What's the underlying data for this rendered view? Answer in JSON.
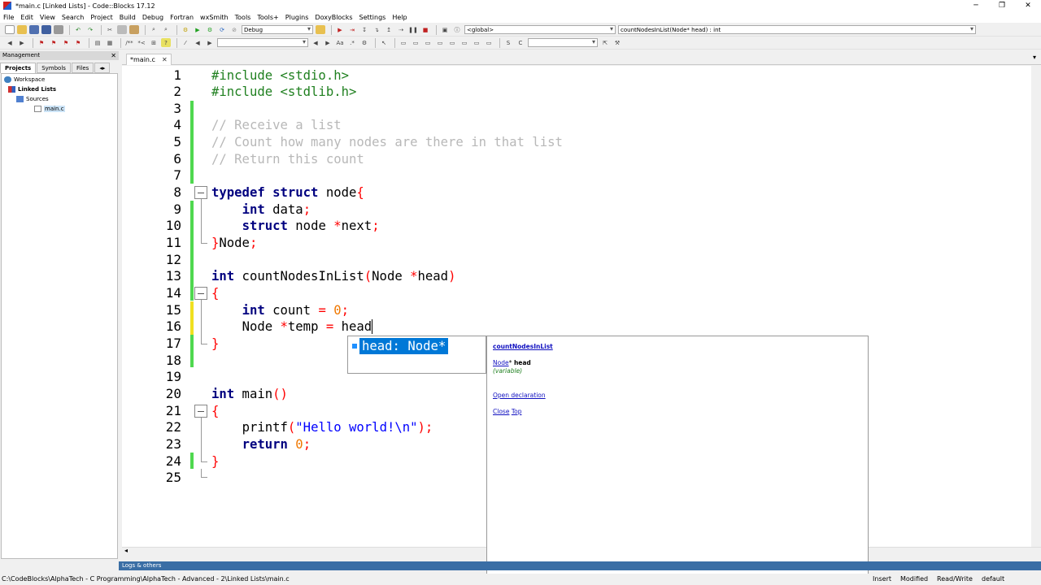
{
  "window": {
    "title": "*main.c [Linked Lists] - Code::Blocks 17.12",
    "controls": [
      "─",
      "❐",
      "✕"
    ]
  },
  "menu": [
    "File",
    "Edit",
    "View",
    "Search",
    "Project",
    "Build",
    "Debug",
    "Fortran",
    "wxSmith",
    "Tools",
    "Tools+",
    "Plugins",
    "DoxyBlocks",
    "Settings",
    "Help"
  ],
  "toolbar": {
    "build_target": "Debug",
    "scope": "<global>",
    "function": "countNodesInList(Node* head) : int"
  },
  "management": {
    "title": "Management",
    "close": "✕",
    "tabs": [
      "Projects",
      "Symbols",
      "Files"
    ],
    "tree": {
      "workspace": "Workspace",
      "project": "Linked Lists",
      "folder": "Sources",
      "file": "main.c"
    }
  },
  "editor": {
    "tab_label": "*main.c",
    "tab_close": "✕",
    "tabs_menu": "▾",
    "line_numbers": [
      "1",
      "2",
      "3",
      "4",
      "5",
      "6",
      "7",
      "8",
      "9",
      "10",
      "11",
      "12",
      "13",
      "14",
      "15",
      "16",
      "17",
      "18",
      "19",
      "20",
      "21",
      "22",
      "23",
      "24",
      "25"
    ],
    "code": {
      "l1": "#include <stdio.h>",
      "l2": "#include <stdlib.h>",
      "l4": "// Receive a list",
      "l5": "// Count how many nodes are there in that list",
      "l6": "// Return this count",
      "l8_kw": "typedef struct",
      "l8_rest": " node",
      "l8_brace": "{",
      "l9_kw": "int",
      "l9_rest": " data",
      "l9_semi": ";",
      "l10_kw": "struct",
      "l10_rest": " node ",
      "l10_star": "*",
      "l10_name": "next",
      "l10_semi": ";",
      "l11_brace": "}",
      "l11_name": "Node",
      "l11_semi": ";",
      "l13_kw": "int",
      "l13_name": " countNodesInList",
      "l13_paren": "(",
      "l13_type": "Node ",
      "l13_star": "*",
      "l13_param": "head",
      "l13_close": ")",
      "l14_brace": "{",
      "l15_kw": "int",
      "l15_name": " count ",
      "l15_eq": "=",
      "l15_num": " 0",
      "l15_semi": ";",
      "l16_type": "Node ",
      "l16_star": "*",
      "l16_name": "temp ",
      "l16_eq": "=",
      "l16_val": " head",
      "l17_brace": "}",
      "l20_kw": "int",
      "l20_name": " main",
      "l20_paren": "()",
      "l21_brace": "{",
      "l22_fn": "printf",
      "l22_open": "(",
      "l22_str": "\"Hello world!\\n\"",
      "l22_close": ");",
      "l23_kw": "return",
      "l23_num": " 0",
      "l23_semi": ";",
      "l24_brace": "}"
    }
  },
  "autocomplete": {
    "item": "head: Node*"
  },
  "doc_popup": {
    "title": "countNodesInList",
    "sig_type": "Node",
    "sig_star": "*",
    "sig_name": " head",
    "kind": "(variable)",
    "open_declaration": "Open declaration",
    "close": "Close",
    "top": "Top"
  },
  "logs_label": "Logs & others",
  "status": {
    "path": "C:\\CodeBlocks\\AlphaTech - C Programming\\AlphaTech - Advanced - 2\\Linked Lists\\main.c",
    "insert": "Insert",
    "modified": "Modified",
    "rw": "Read/Write",
    "default": "default"
  }
}
